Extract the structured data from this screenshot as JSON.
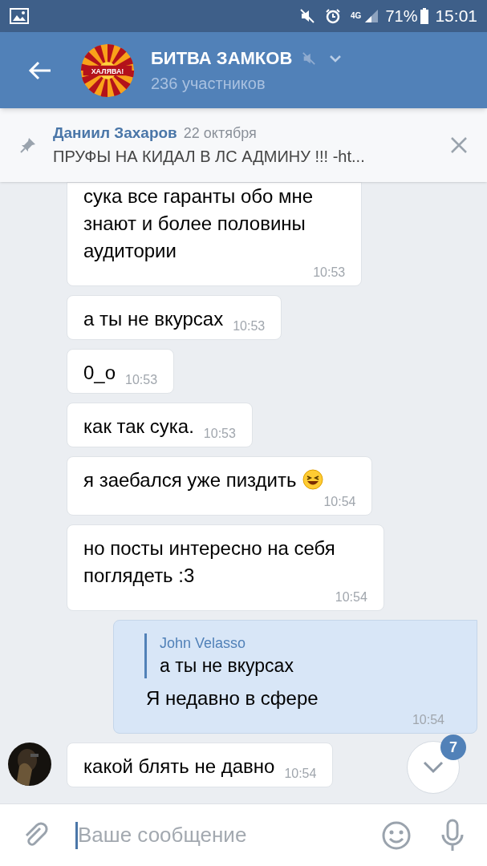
{
  "status_bar": {
    "network": "4G",
    "battery": "71%",
    "time": "15:01"
  },
  "header": {
    "avatar_label": "ХАЛЯВА!",
    "title": "БИТВА ЗАМКОВ",
    "muted": true,
    "subtitle": "236 участников"
  },
  "pinned": {
    "author": "Даниил Захаров",
    "date": "22 октября",
    "text": "ПРУФЫ НА КИДАЛ В ЛС АДМИНУ !!! -ht..."
  },
  "messages": [
    {
      "kind": "incoming",
      "lines": [
        "сука все гаранты обо мне",
        "знают и более половины",
        "аудитории"
      ],
      "time": "10:53"
    },
    {
      "kind": "incoming",
      "lines": [
        "а ты не вкурсах"
      ],
      "time": "10:53"
    },
    {
      "kind": "incoming",
      "lines": [
        "0_o"
      ],
      "time": "10:53"
    },
    {
      "kind": "incoming",
      "lines": [
        "как так сука."
      ],
      "time": "10:53"
    },
    {
      "kind": "incoming",
      "lines": [
        "я заебался уже пиздить"
      ],
      "emoji": true,
      "time": "10:54"
    },
    {
      "kind": "incoming",
      "lines": [
        "но посты интересно на себя",
        "поглядеть :3"
      ],
      "time": "10:54"
    },
    {
      "kind": "outgoing",
      "reply": {
        "author": "John Velasso",
        "text": "а ты не вкурсах"
      },
      "lines": [
        "Я недавно в сфере"
      ],
      "time": "10:54"
    },
    {
      "kind": "incoming",
      "avatar": true,
      "lines": [
        "какой блять не давно"
      ],
      "time": "10:54"
    }
  ],
  "scroll_button": {
    "badge": "7"
  },
  "composer": {
    "placeholder": "Ваше сообщение"
  }
}
